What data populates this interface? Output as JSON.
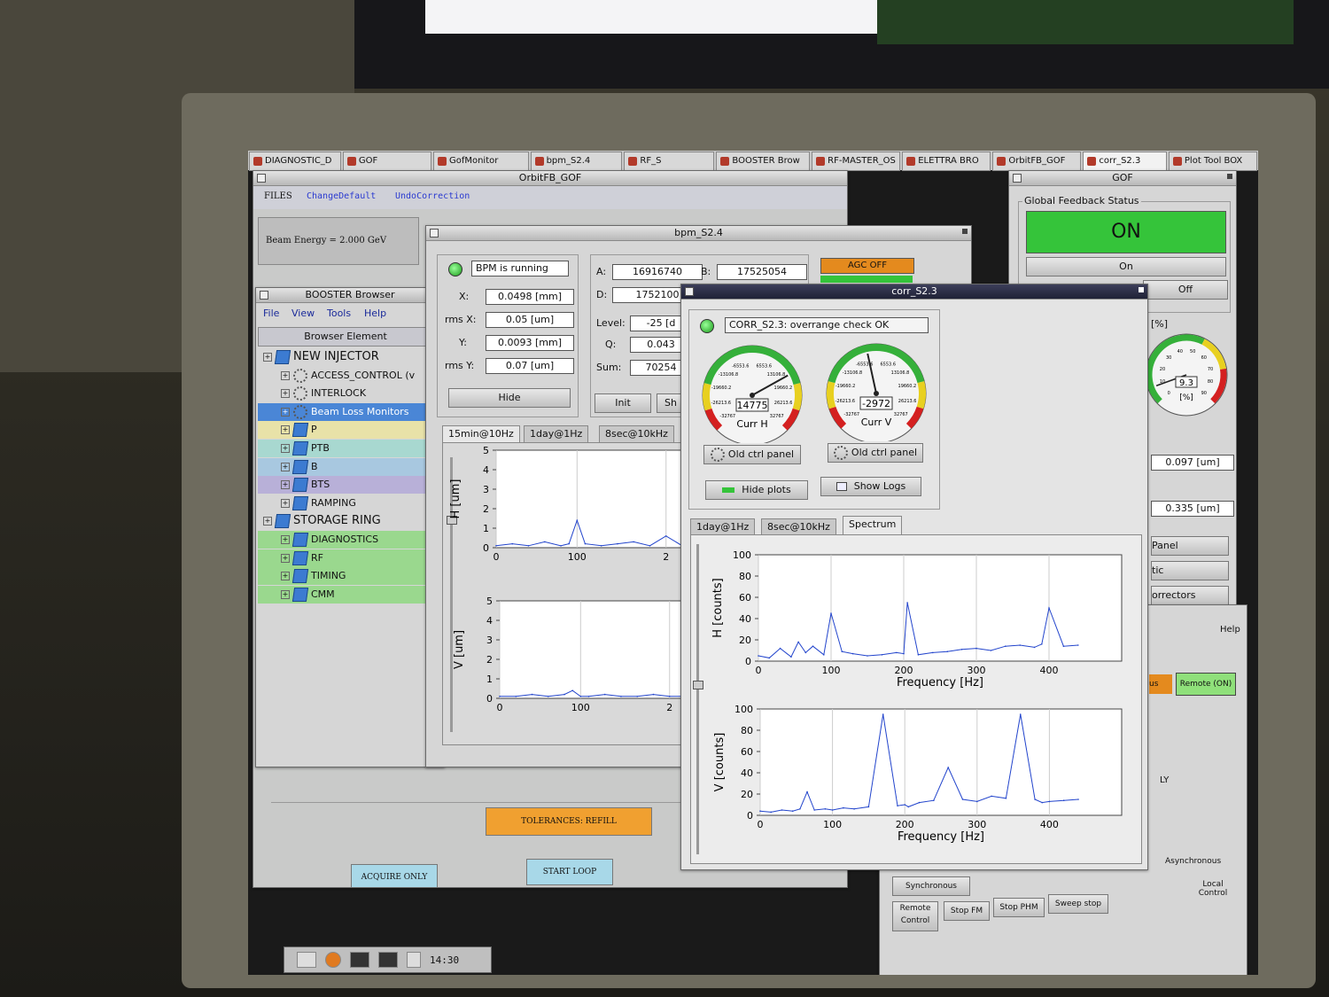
{
  "taskbar": {
    "tasks": [
      "DIAGNOSTIC_D",
      "GOF",
      "GofMonitor",
      "bpm_S2.4",
      "RF_S",
      "BOOSTER Brow",
      "RF-MASTER_OS",
      "ELETTRA BRO",
      "OrbitFB_GOF",
      "corr_S2.3",
      "Plot Tool BOX"
    ],
    "active_index": 9
  },
  "orbitfb": {
    "title": "OrbitFB_GOF",
    "menu": [
      "FILES",
      "ChangeDefault",
      "UndoCorrection"
    ],
    "beam_energy": "Beam Energy = 2.000 GeV",
    "tolerances_button": "TOLERANCES: REFILL",
    "acquire_button": "ACQUIRE ONLY",
    "start_loop_button": "START LOOP"
  },
  "booster": {
    "title": "BOOSTER Browser",
    "menu": [
      "File",
      "View",
      "Tools",
      "Help"
    ],
    "column_header": "Browser Element",
    "tree": [
      {
        "label": "NEW INJECTOR",
        "level": 0,
        "kind": "folder",
        "bg": "#d6d6d6"
      },
      {
        "label": "ACCESS_CONTROL (v",
        "level": 1,
        "kind": "gear",
        "bg": "#d6d6d6"
      },
      {
        "label": "INTERLOCK",
        "level": 1,
        "kind": "gear",
        "bg": "#d6d6d6"
      },
      {
        "label": "Beam Loss Monitors",
        "level": 1,
        "kind": "gear",
        "bg": "#4a86d6",
        "selected": true
      },
      {
        "label": "P",
        "level": 1,
        "kind": "folder",
        "bg": "#e8e2a8"
      },
      {
        "label": "PTB",
        "level": 1,
        "kind": "folder",
        "bg": "#a8d8d0"
      },
      {
        "label": "B",
        "level": 1,
        "kind": "folder",
        "bg": "#a8c8e0"
      },
      {
        "label": "BTS",
        "level": 1,
        "kind": "folder",
        "bg": "#b8b0d8"
      },
      {
        "label": "RAMPING",
        "level": 1,
        "kind": "folder",
        "bg": "#d6d6d6"
      },
      {
        "label": "STORAGE RING",
        "level": 0,
        "kind": "folder",
        "bg": "#d6d6d6"
      },
      {
        "label": "DIAGNOSTICS",
        "level": 1,
        "kind": "folder",
        "bg": "#9ad88e"
      },
      {
        "label": "RF",
        "level": 1,
        "kind": "folder",
        "bg": "#9ad88e"
      },
      {
        "label": "TIMING",
        "level": 1,
        "kind": "folder",
        "bg": "#9ad88e"
      },
      {
        "label": "CMM",
        "level": 1,
        "kind": "folder",
        "bg": "#9ad88e"
      }
    ]
  },
  "bpm": {
    "title": "bpm_S2.4",
    "status": "BPM is running",
    "x_label": "X:",
    "x_value": "0.0498 [mm]",
    "rmsx_label": "rms X:",
    "rmsx_value": "0.05 [um]",
    "y_label": "Y:",
    "y_value": "0.0093 [mm]",
    "rmsy_label": "rms Y:",
    "rmsy_value": "0.07 [um]",
    "hide_button": "Hide",
    "a_label": "A:",
    "a_value": "16916740",
    "b_label": "B:",
    "b_value": "17525054",
    "d_label": "D:",
    "d_value": "1752100",
    "level_label": "Level:",
    "level_value": "-25 [d",
    "q_label": "Q:",
    "q_value": "0.043",
    "sum_label": "Sum:",
    "sum_value": "70254",
    "init_button": "Init",
    "sh_button": "Sh",
    "agc_label": "AGC OFF",
    "tabs": [
      "15min@10Hz",
      "1day@1Hz",
      "8sec@10kHz"
    ],
    "plot_h_ylabel": "H [um]",
    "plot_v_ylabel": "V [um]",
    "plot_yticks": [
      "5",
      "4",
      "3",
      "2",
      "1",
      "0"
    ],
    "plot_xticks": [
      "0",
      "100",
      "2"
    ]
  },
  "corr": {
    "title": "corr_S2.3",
    "status": "CORR_S2.3: overrange check OK",
    "gauge_h": {
      "value": "14775",
      "label": "Curr H",
      "ticks": [
        "-6553.6",
        "6553.6",
        "-13106.8",
        "13106.8",
        "-19660.2",
        "19660.2",
        "-26213.6",
        "26213.6",
        "-32767",
        "32767"
      ],
      "needle": 14775
    },
    "gauge_v": {
      "value": "-2972",
      "label": "Curr V",
      "ticks": [
        "-6553.6",
        "6553.6",
        "-13106.8",
        "13106.8",
        "-19660.2",
        "19660.2",
        "-26213.6",
        "26213.6",
        "-32767",
        "32767"
      ],
      "needle": -2972
    },
    "old_ctrl_button": "Old ctrl panel",
    "hide_plots_button": "Hide plots",
    "show_logs_button": "Show Logs",
    "tabs": [
      "1day@1Hz",
      "8sec@10kHz",
      "Spectrum"
    ],
    "selected_tab": 2,
    "plot_h_ylabel": "H [counts]",
    "plot_v_ylabel": "V [counts]",
    "xlabel": "Frequency [Hz]",
    "yticks": [
      "100",
      "80",
      "60",
      "40",
      "20",
      "0"
    ],
    "xticks": [
      "0",
      "100",
      "200",
      "300",
      "400"
    ]
  },
  "gof": {
    "title": "GOF",
    "group_label": "Global Feedback Status",
    "status": "ON",
    "on_button": "On",
    "off_button": "Off",
    "percent_label": "[%]",
    "gauge_value": "9.3",
    "gauge_unit": "[%]",
    "gauge_ticks": [
      "0",
      "10",
      "20",
      "30",
      "40",
      "50",
      "60",
      "70",
      "80",
      "90"
    ],
    "rms1": "0.097 [um]",
    "rms2": "0.335 [um]",
    "panel_label": "Panel",
    "tic_label": "tic",
    "correctors_label": "orrectors"
  },
  "rfpanel": {
    "help": "Help",
    "us_label": "us",
    "remote_on": "Remote (ON)",
    "ly_label": "LY",
    "asynchronous": "Asynchronous",
    "synchronous": "Synchronous",
    "local_control": "Local Control",
    "remote_control": "Remote Control",
    "stop_fm": "Stop FM",
    "stop_phm": "Stop PHM",
    "sweep_stop": "Sweep stop"
  },
  "dock": {
    "clock": "14:30"
  },
  "colors": {
    "on_green": "#35c43a",
    "agc_orange": "#e48a1e",
    "tolerance_orange": "#f0a030",
    "remote_green": "#8fe07a",
    "selected_blue": "#4a86d6",
    "series_blue": "#2244cc"
  },
  "chart_data": [
    {
      "type": "line",
      "series": [
        {
          "values": [
            0.1,
            0.2,
            0.1,
            0.3,
            0.1,
            0.2,
            1.4,
            0.2,
            0.1,
            0.2,
            0.3,
            0.1,
            0.6,
            0.1
          ]
        }
      ],
      "x": [
        0,
        20,
        40,
        60,
        80,
        90,
        100,
        110,
        130,
        150,
        170,
        190,
        210,
        230
      ],
      "ylabel": "H [um]",
      "ylim": [
        0,
        5
      ]
    },
    {
      "type": "line",
      "series": [
        {
          "values": [
            0.1,
            0.1,
            0.2,
            0.1,
            0.2,
            0.4,
            0.1,
            0.1,
            0.2,
            0.1,
            0.1,
            0.2,
            0.1,
            0.1
          ]
        }
      ],
      "x": [
        0,
        20,
        40,
        60,
        80,
        90,
        100,
        110,
        130,
        150,
        170,
        190,
        210,
        230
      ],
      "ylabel": "V [um]",
      "ylim": [
        0,
        5
      ]
    },
    {
      "type": "line",
      "series": [
        {
          "values": [
            5,
            3,
            12,
            4,
            18,
            8,
            14,
            6,
            45,
            9,
            7,
            5,
            6,
            8,
            7,
            55,
            6,
            8,
            9,
            11,
            12,
            10,
            14,
            15,
            13,
            16,
            50,
            14,
            15
          ]
        }
      ],
      "x": [
        0,
        15,
        30,
        45,
        55,
        65,
        75,
        90,
        100,
        115,
        130,
        150,
        170,
        190,
        200,
        205,
        220,
        240,
        260,
        280,
        300,
        320,
        340,
        360,
        380,
        390,
        400,
        420,
        440
      ],
      "xlabel": "Frequency [Hz]",
      "ylabel": "H [counts]",
      "ylim": [
        0,
        100
      ]
    },
    {
      "type": "line",
      "series": [
        {
          "values": [
            4,
            3,
            5,
            4,
            6,
            22,
            5,
            6,
            5,
            7,
            6,
            8,
            95,
            9,
            10,
            8,
            12,
            14,
            45,
            15,
            13,
            18,
            16,
            95,
            15,
            12,
            13,
            14,
            15
          ]
        }
      ],
      "x": [
        0,
        15,
        30,
        45,
        55,
        65,
        75,
        90,
        100,
        115,
        130,
        150,
        170,
        190,
        200,
        205,
        220,
        240,
        260,
        280,
        300,
        320,
        340,
        360,
        380,
        390,
        400,
        420,
        440
      ],
      "xlabel": "Frequency [Hz]",
      "ylabel": "V [counts]",
      "ylim": [
        0,
        100
      ]
    }
  ]
}
